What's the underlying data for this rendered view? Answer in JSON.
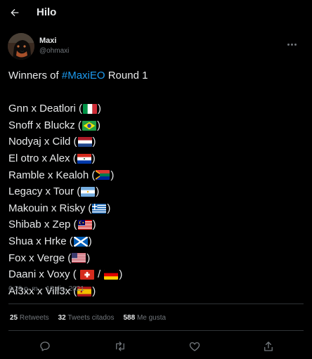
{
  "header": {
    "title": "Hilo",
    "back_icon": "arrow-left-icon"
  },
  "author": {
    "name": "Maxi",
    "handle": "@ohmaxi",
    "more_icon": "more-horizontal-icon"
  },
  "tweet": {
    "intro_prefix": "Winners of ",
    "hashtag": "#MaxiEO",
    "intro_suffix": " Round 1",
    "lines": [
      {
        "text": "Gnn x Deatlori (",
        "flags": [
          "italy"
        ],
        "end": ")"
      },
      {
        "text": "Snoff x Bluckz (",
        "flags": [
          "brazil"
        ],
        "end": ")"
      },
      {
        "text": "Nodyaj x Cild (",
        "flags": [
          "netherlands"
        ],
        "end": ")"
      },
      {
        "text": "El otro x Alex (",
        "flags": [
          "paraguay"
        ],
        "end": ")"
      },
      {
        "text": "Ramble x Kealoh (",
        "flags": [
          "south-africa"
        ],
        "end": ")"
      },
      {
        "text": "Legacy x Tour (",
        "flags": [
          "argentina"
        ],
        "end": ")"
      },
      {
        "text": "Makouin x Risky (",
        "flags": [
          "greece"
        ],
        "end": ")"
      },
      {
        "text": "Shibab x Zep (",
        "flags": [
          "malaysia"
        ],
        "end": ")"
      },
      {
        "text": "Shua x Hrke (",
        "flags": [
          "scotland"
        ],
        "end": ")"
      },
      {
        "text": "Fox x Verge (",
        "flags": [
          "usa"
        ],
        "end": ")"
      },
      {
        "text": "Daani x Voxy ( ",
        "flags": [
          "switzerland",
          "germany"
        ],
        "separator": " / ",
        "end": ")"
      },
      {
        "text": "Al3xx x Vill3x (",
        "flags": [
          "spain"
        ],
        "end": ")"
      }
    ]
  },
  "timestamp": "6:29 p. m. · 10 dic. 2021",
  "stats": {
    "retweets_count": "25",
    "retweets_label": "Retweets",
    "quotes_count": "32",
    "quotes_label": "Tweets citados",
    "likes_count": "588",
    "likes_label": "Me gusta"
  },
  "actions": [
    "reply-icon",
    "retweet-icon",
    "like-icon",
    "share-icon"
  ],
  "colors": {
    "background": "#000000",
    "text": "#e7e9ea",
    "muted": "#71767b",
    "accent": "#1d9bf0",
    "divider": "#2f3336"
  }
}
